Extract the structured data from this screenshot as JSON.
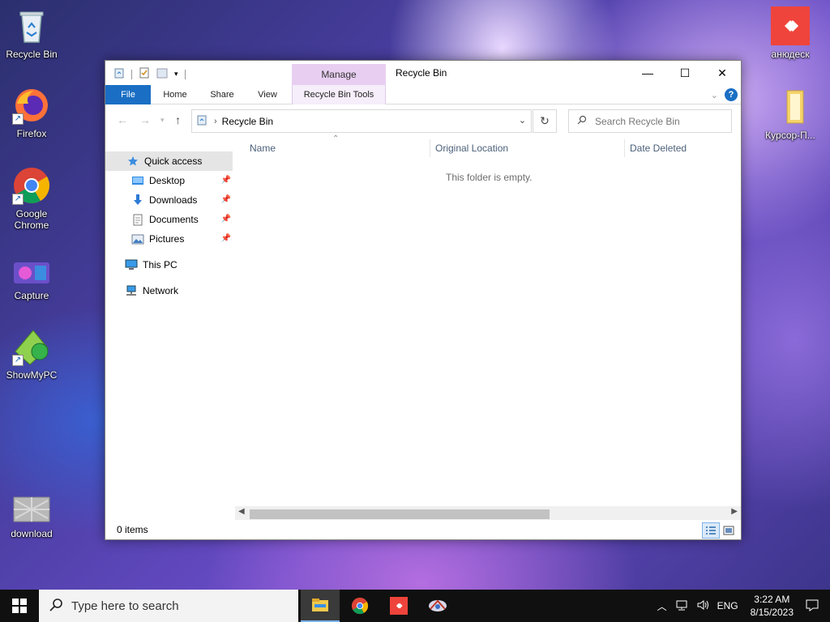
{
  "desktop": {
    "icons_left": [
      {
        "label": "Recycle Bin",
        "icon": "recycle-bin-icon"
      },
      {
        "label": "Firefox",
        "icon": "firefox-icon"
      },
      {
        "label": "Google Chrome",
        "icon": "chrome-icon"
      },
      {
        "label": "Capture",
        "icon": "capture-icon"
      },
      {
        "label": "ShowMyPC",
        "icon": "showmypc-icon"
      },
      {
        "label": "download",
        "icon": "image-file-icon"
      }
    ],
    "icons_right": [
      {
        "label": "анюдеск",
        "icon": "anydesk-icon"
      },
      {
        "label": "Курсор-П...",
        "icon": "folder-icon"
      }
    ]
  },
  "window": {
    "title": "Recycle Bin",
    "manage_label": "Manage",
    "tabs": {
      "file": "File",
      "home": "Home",
      "share": "Share",
      "view": "View",
      "recycle_bin_tools": "Recycle Bin Tools"
    },
    "help_label": "?",
    "controls": {
      "minimize": "—",
      "maximize": "☐",
      "close": "✕"
    },
    "address": {
      "path": "Recycle Bin"
    },
    "search": {
      "placeholder": "Search Recycle Bin"
    },
    "nav": {
      "quick_access": "Quick access",
      "desktop": "Desktop",
      "downloads": "Downloads",
      "documents": "Documents",
      "pictures": "Pictures",
      "this_pc": "This PC",
      "network": "Network"
    },
    "columns": {
      "name": "Name",
      "original_location": "Original Location",
      "date_deleted": "Date Deleted"
    },
    "empty_message": "This folder is empty.",
    "status": {
      "count": "0 items"
    }
  },
  "taskbar": {
    "search_placeholder": "Type here to search",
    "language": "ENG",
    "time": "3:22 AM",
    "date": "8/15/2023"
  }
}
